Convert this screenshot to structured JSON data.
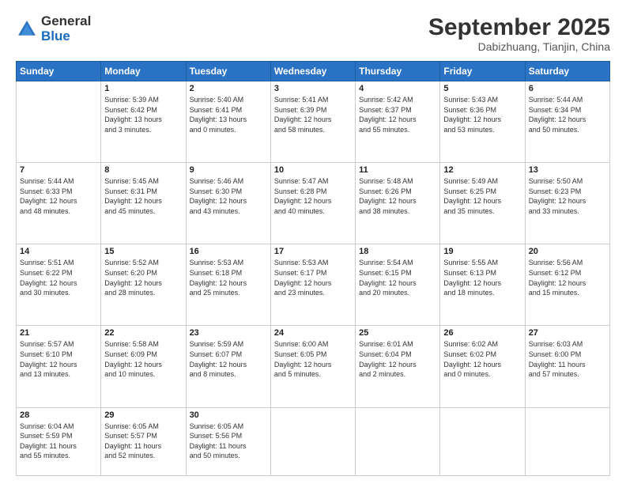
{
  "header": {
    "logo": {
      "general": "General",
      "blue": "Blue"
    },
    "month_year": "September 2025",
    "location": "Dabizhuang, Tianjin, China"
  },
  "days_of_week": [
    "Sunday",
    "Monday",
    "Tuesday",
    "Wednesday",
    "Thursday",
    "Friday",
    "Saturday"
  ],
  "weeks": [
    [
      {
        "day": "",
        "info": ""
      },
      {
        "day": "1",
        "info": "Sunrise: 5:39 AM\nSunset: 6:42 PM\nDaylight: 13 hours\nand 3 minutes."
      },
      {
        "day": "2",
        "info": "Sunrise: 5:40 AM\nSunset: 6:41 PM\nDaylight: 13 hours\nand 0 minutes."
      },
      {
        "day": "3",
        "info": "Sunrise: 5:41 AM\nSunset: 6:39 PM\nDaylight: 12 hours\nand 58 minutes."
      },
      {
        "day": "4",
        "info": "Sunrise: 5:42 AM\nSunset: 6:37 PM\nDaylight: 12 hours\nand 55 minutes."
      },
      {
        "day": "5",
        "info": "Sunrise: 5:43 AM\nSunset: 6:36 PM\nDaylight: 12 hours\nand 53 minutes."
      },
      {
        "day": "6",
        "info": "Sunrise: 5:44 AM\nSunset: 6:34 PM\nDaylight: 12 hours\nand 50 minutes."
      }
    ],
    [
      {
        "day": "7",
        "info": "Sunrise: 5:44 AM\nSunset: 6:33 PM\nDaylight: 12 hours\nand 48 minutes."
      },
      {
        "day": "8",
        "info": "Sunrise: 5:45 AM\nSunset: 6:31 PM\nDaylight: 12 hours\nand 45 minutes."
      },
      {
        "day": "9",
        "info": "Sunrise: 5:46 AM\nSunset: 6:30 PM\nDaylight: 12 hours\nand 43 minutes."
      },
      {
        "day": "10",
        "info": "Sunrise: 5:47 AM\nSunset: 6:28 PM\nDaylight: 12 hours\nand 40 minutes."
      },
      {
        "day": "11",
        "info": "Sunrise: 5:48 AM\nSunset: 6:26 PM\nDaylight: 12 hours\nand 38 minutes."
      },
      {
        "day": "12",
        "info": "Sunrise: 5:49 AM\nSunset: 6:25 PM\nDaylight: 12 hours\nand 35 minutes."
      },
      {
        "day": "13",
        "info": "Sunrise: 5:50 AM\nSunset: 6:23 PM\nDaylight: 12 hours\nand 33 minutes."
      }
    ],
    [
      {
        "day": "14",
        "info": "Sunrise: 5:51 AM\nSunset: 6:22 PM\nDaylight: 12 hours\nand 30 minutes."
      },
      {
        "day": "15",
        "info": "Sunrise: 5:52 AM\nSunset: 6:20 PM\nDaylight: 12 hours\nand 28 minutes."
      },
      {
        "day": "16",
        "info": "Sunrise: 5:53 AM\nSunset: 6:18 PM\nDaylight: 12 hours\nand 25 minutes."
      },
      {
        "day": "17",
        "info": "Sunrise: 5:53 AM\nSunset: 6:17 PM\nDaylight: 12 hours\nand 23 minutes."
      },
      {
        "day": "18",
        "info": "Sunrise: 5:54 AM\nSunset: 6:15 PM\nDaylight: 12 hours\nand 20 minutes."
      },
      {
        "day": "19",
        "info": "Sunrise: 5:55 AM\nSunset: 6:13 PM\nDaylight: 12 hours\nand 18 minutes."
      },
      {
        "day": "20",
        "info": "Sunrise: 5:56 AM\nSunset: 6:12 PM\nDaylight: 12 hours\nand 15 minutes."
      }
    ],
    [
      {
        "day": "21",
        "info": "Sunrise: 5:57 AM\nSunset: 6:10 PM\nDaylight: 12 hours\nand 13 minutes."
      },
      {
        "day": "22",
        "info": "Sunrise: 5:58 AM\nSunset: 6:09 PM\nDaylight: 12 hours\nand 10 minutes."
      },
      {
        "day": "23",
        "info": "Sunrise: 5:59 AM\nSunset: 6:07 PM\nDaylight: 12 hours\nand 8 minutes."
      },
      {
        "day": "24",
        "info": "Sunrise: 6:00 AM\nSunset: 6:05 PM\nDaylight: 12 hours\nand 5 minutes."
      },
      {
        "day": "25",
        "info": "Sunrise: 6:01 AM\nSunset: 6:04 PM\nDaylight: 12 hours\nand 2 minutes."
      },
      {
        "day": "26",
        "info": "Sunrise: 6:02 AM\nSunset: 6:02 PM\nDaylight: 12 hours\nand 0 minutes."
      },
      {
        "day": "27",
        "info": "Sunrise: 6:03 AM\nSunset: 6:00 PM\nDaylight: 11 hours\nand 57 minutes."
      }
    ],
    [
      {
        "day": "28",
        "info": "Sunrise: 6:04 AM\nSunset: 5:59 PM\nDaylight: 11 hours\nand 55 minutes."
      },
      {
        "day": "29",
        "info": "Sunrise: 6:05 AM\nSunset: 5:57 PM\nDaylight: 11 hours\nand 52 minutes."
      },
      {
        "day": "30",
        "info": "Sunrise: 6:05 AM\nSunset: 5:56 PM\nDaylight: 11 hours\nand 50 minutes."
      },
      {
        "day": "",
        "info": ""
      },
      {
        "day": "",
        "info": ""
      },
      {
        "day": "",
        "info": ""
      },
      {
        "day": "",
        "info": ""
      }
    ]
  ]
}
